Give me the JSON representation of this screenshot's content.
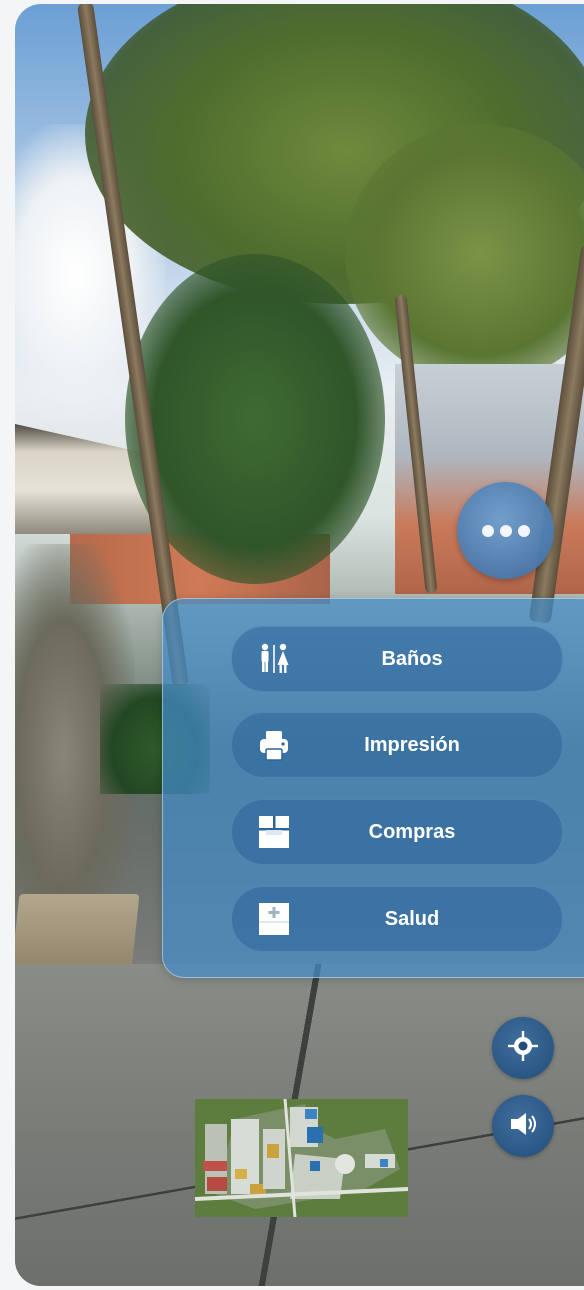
{
  "menu": {
    "toggle_icon": "more-dots-icon",
    "items": [
      {
        "label": "Baños",
        "icon": "restroom-icon"
      },
      {
        "label": "Impresión",
        "icon": "printer-icon"
      },
      {
        "label": "Compras",
        "icon": "shop-icon"
      },
      {
        "label": "Salud",
        "icon": "medical-icon"
      }
    ]
  },
  "controls": {
    "recenter_icon": "crosshair-icon",
    "audio_icon": "speaker-icon"
  },
  "minimap": {
    "icon": "campus-map"
  },
  "colors": {
    "panel": "#428cc8",
    "button": "#2d649b",
    "control": "#224d7a"
  }
}
